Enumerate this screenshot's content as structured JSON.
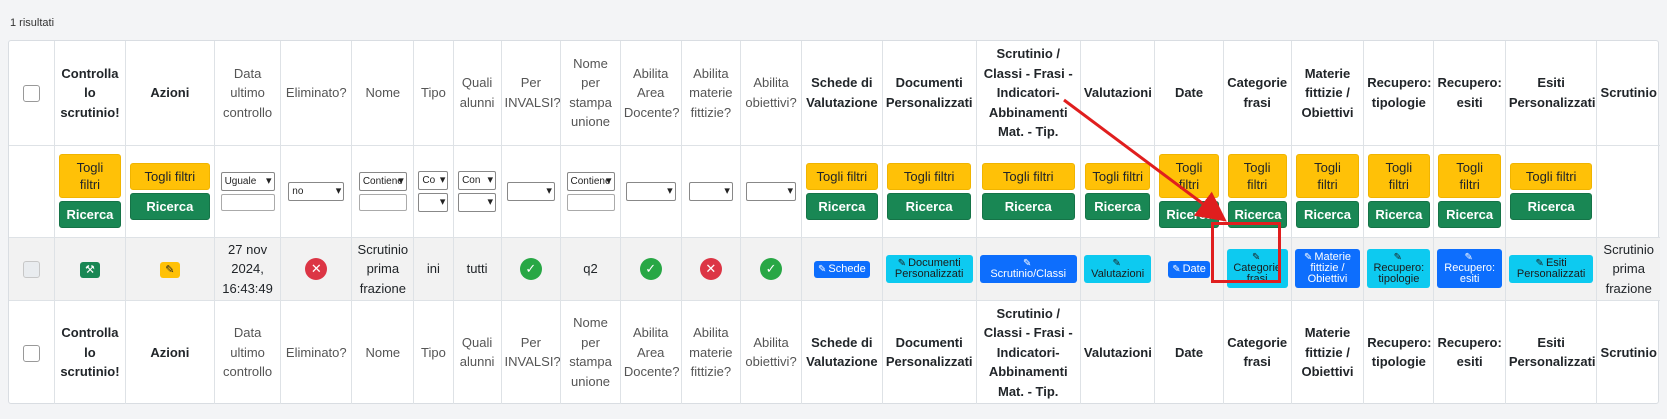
{
  "results_label": "1 risultati",
  "headers": [
    {
      "label": "",
      "bold": true
    },
    {
      "label": "Controlla lo scrutinio!",
      "bold": true
    },
    {
      "label": "Azioni",
      "bold": true
    },
    {
      "label": "Data ultimo controllo",
      "bold": false
    },
    {
      "label": "Eliminato?",
      "bold": false
    },
    {
      "label": "Nome",
      "bold": false
    },
    {
      "label": "Tipo",
      "bold": false
    },
    {
      "label": "Quali alunni",
      "bold": false
    },
    {
      "label": "Per INVALSI?",
      "bold": false
    },
    {
      "label": "Nome per stampa unione",
      "bold": false
    },
    {
      "label": "Abilita Area Docente?",
      "bold": false
    },
    {
      "label": "Abilita materie fittizie?",
      "bold": false
    },
    {
      "label": "Abilita obiettivi?",
      "bold": false
    },
    {
      "label": "Schede di Valutazione",
      "bold": true
    },
    {
      "label": "Documenti Personalizzati",
      "bold": true
    },
    {
      "label": "Scrutinio / Classi - Frasi - Indicatori- Abbinamenti Mat. - Tip.",
      "bold": true
    },
    {
      "label": "Valutazioni",
      "bold": true
    },
    {
      "label": "Date",
      "bold": true
    },
    {
      "label": "Categorie frasi",
      "bold": true
    },
    {
      "label": "Materie fittizie / Obiettivi",
      "bold": true
    },
    {
      "label": "Recupero: tipologie",
      "bold": true
    },
    {
      "label": "Recupero: esiti",
      "bold": true
    },
    {
      "label": "Esiti Personalizzati",
      "bold": true
    },
    {
      "label": "Scrutinio",
      "bold": true
    }
  ],
  "filters": {
    "togli_filtri": "Togli filtri",
    "ricerca": "Ricerca",
    "select_uguale": "Uguale",
    "select_no": "no",
    "select_contiene": "Contiene",
    "select_co": "Co",
    "select_con": "Con"
  },
  "row": {
    "date": "27 nov 2024, 16:43:49",
    "nome": "Scrutinio prima frazione",
    "tipo": "ini",
    "quali_alunni": "tutti",
    "stampa_unione": "q2",
    "scrutinio": "Scrutinio prima frazione",
    "buttons": {
      "schede": "Schede",
      "documenti": "Documenti Personalizzati",
      "scrutinio_classi": "Scrutinio/Classi",
      "valutazioni": "Valutazioni",
      "date": "Date",
      "categorie": "Categorie frasi",
      "materie": "Materie fittizie / Obiettivi",
      "rec_tipologie": "Recupero: tipologie",
      "rec_esiti": "Recupero: esiti",
      "esiti_pers": "Esiti Personalizzati"
    }
  },
  "colors": {
    "warning": "#ffc107",
    "success": "#198754",
    "primary": "#0d6efd",
    "info": "#0dcaf0",
    "danger": "#dc3545",
    "annotation": "#e01e1e"
  },
  "icons": {
    "wrench": "wrench-icon",
    "edit": "edit-icon",
    "check": "check-icon",
    "cross": "x-icon"
  }
}
